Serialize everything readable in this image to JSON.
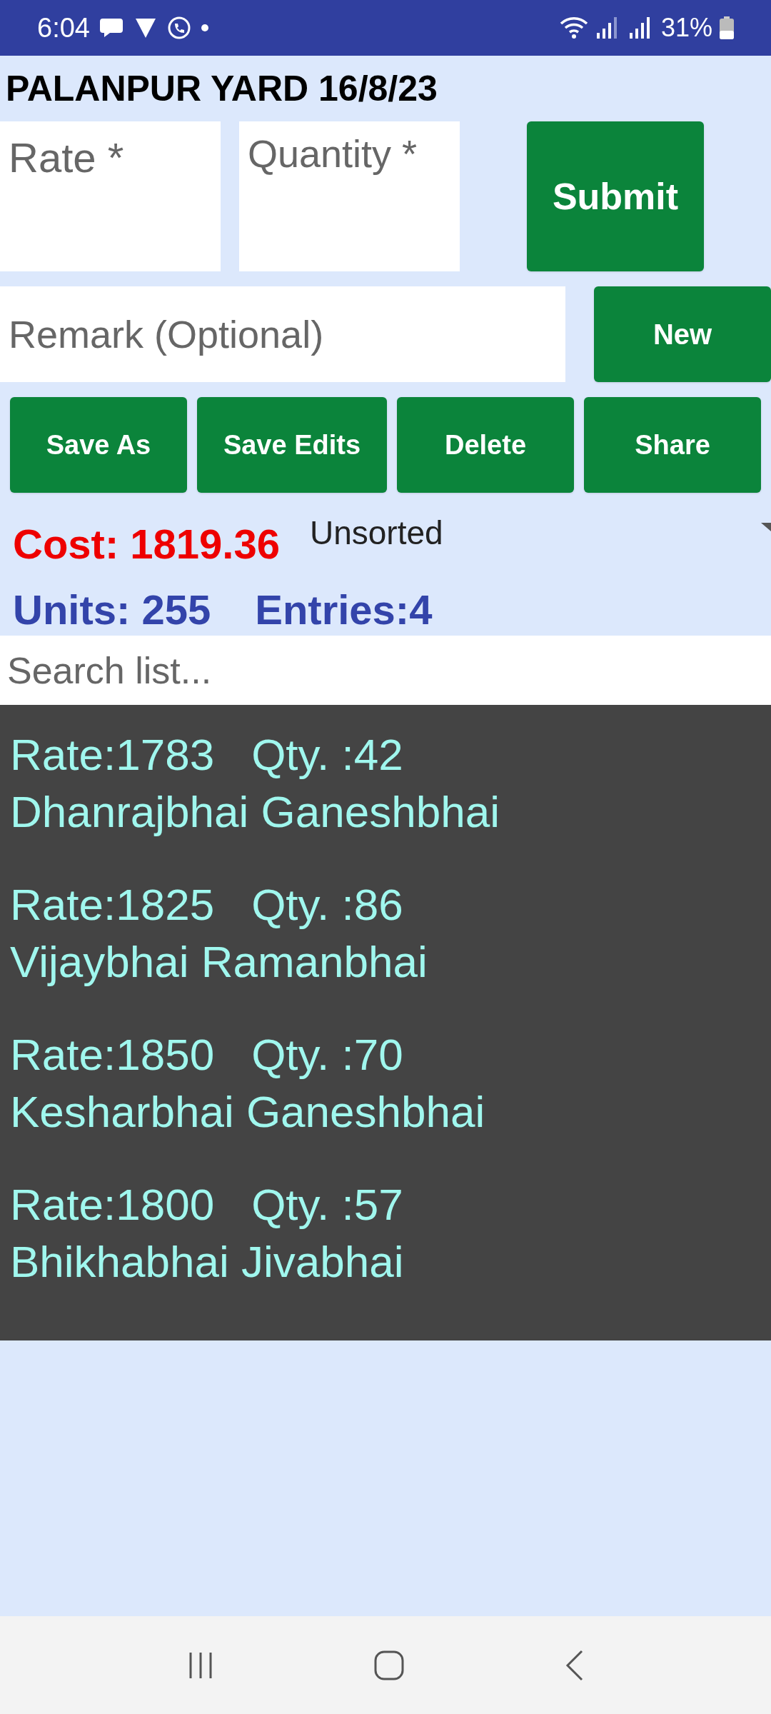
{
  "status_bar": {
    "time": "6:04",
    "battery": "31%"
  },
  "title": "PALANPUR YARD 16/8/23",
  "rate_field": {
    "placeholder": "Rate *"
  },
  "quantity_field": {
    "placeholder": "Quantity *"
  },
  "submit_button": "Submit",
  "remark_field": {
    "placeholder": "Remark (Optional)"
  },
  "new_button": "New",
  "action_buttons": [
    "Save As",
    "Save Edits",
    "Delete",
    "Share"
  ],
  "cost": "Cost: 1819.36",
  "sort_dropdown": {
    "value": "Unsorted"
  },
  "units": "Units: 255",
  "entries": "Entries:4",
  "search": {
    "placeholder": "Search list..."
  },
  "entries_list": [
    {
      "rate": "Rate:1783",
      "qty": "Qty. :42",
      "name": "Dhanrajbhai Ganeshbhai"
    },
    {
      "rate": "Rate:1825",
      "qty": "Qty. :86",
      "name": "Vijaybhai Ramanbhai"
    },
    {
      "rate": "Rate:1850",
      "qty": "Qty. :70",
      "name": "Kesharbhai Ganeshbhai"
    },
    {
      "rate": "Rate:1800",
      "qty": "Qty. :57",
      "name": "Bhikhabhai Jivabhai"
    }
  ]
}
